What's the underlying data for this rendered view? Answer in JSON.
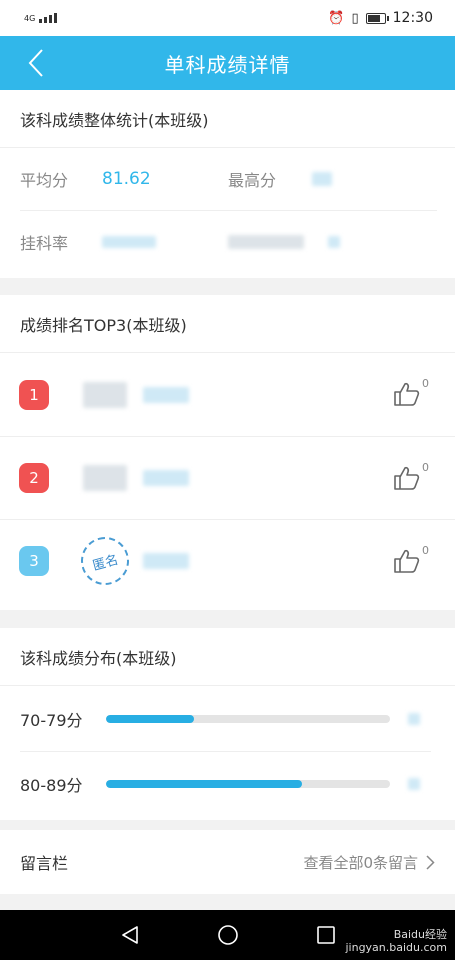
{
  "status_bar": {
    "network": "4G",
    "time": "12:30",
    "battery_level": 0.85
  },
  "header": {
    "title": "单科成绩详情"
  },
  "stats": {
    "title": "该科成绩整体统计(本班级)",
    "avg_label": "平均分",
    "avg_value": "81.62",
    "max_label": "最高分",
    "fail_label": "挂科率"
  },
  "top3": {
    "title": "成绩排名TOP3(本班级)",
    "rows": [
      {
        "rank": "1",
        "badge_color": "#f05252",
        "likes": "0"
      },
      {
        "rank": "2",
        "badge_color": "#f05252",
        "likes": "0"
      },
      {
        "rank": "3",
        "badge_color": "#6ac8ef",
        "likes": "0",
        "avatar_text": "匿名"
      }
    ]
  },
  "distribution": {
    "title": "该科成绩分布(本班级)",
    "rows": [
      {
        "label": "70-79分",
        "fraction": 0.31
      },
      {
        "label": "80-89分",
        "fraction": 0.69
      }
    ]
  },
  "messages": {
    "label": "留言栏",
    "link_text": "查看全部0条留言"
  },
  "colors": {
    "accent": "#31b7ea",
    "bar": "#28aee3"
  },
  "icons": [
    "back-arrow-icon",
    "thumbs-up-icon",
    "chevron-right-icon",
    "back-triangle-icon",
    "home-circle-icon",
    "recents-square-icon"
  ],
  "watermark": {
    "brand": "Baidu经验",
    "url": "jingyan.baidu.com"
  }
}
